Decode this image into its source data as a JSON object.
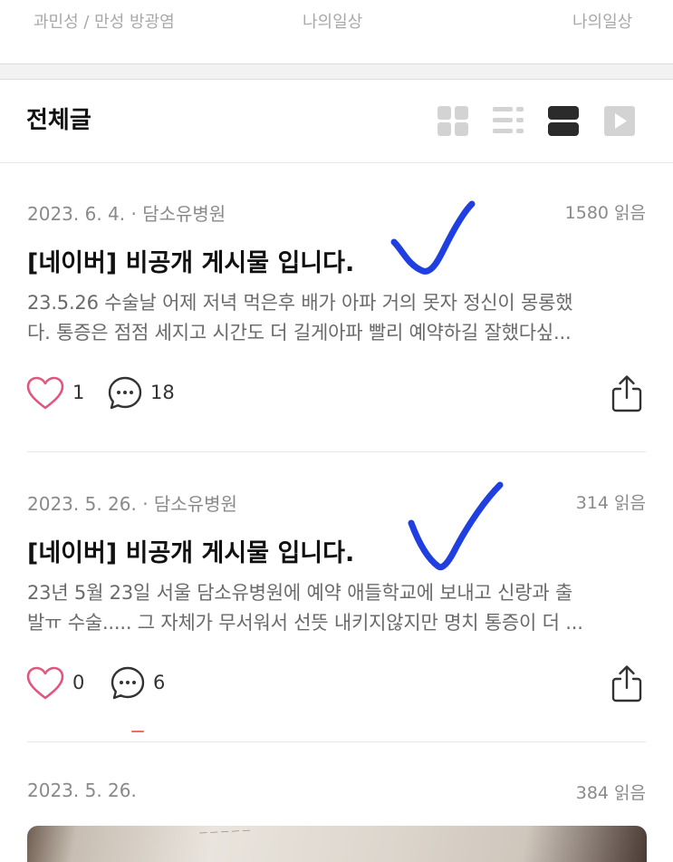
{
  "top_row": {
    "left": "과민성 / 만성 방광염",
    "center": "나의일상",
    "right": "나의일상"
  },
  "section": {
    "title": "전체글"
  },
  "view_modes": [
    "grid-view-icon",
    "list-view-icon",
    "card-view-icon",
    "video-view-icon"
  ],
  "posts": [
    {
      "meta": "2023. 6. 4. · 담소유병원",
      "reads": "1580 읽음",
      "title": "[네이버] 비공개 게시물 입니다.",
      "excerpt_line1": "23.5.26 수술날 어제 저녁 먹은후 배가 아파 거의 못자 정신이 몽롱했",
      "excerpt_line2": "다. 통증은 점점 세지고 시간도 더 길게아파 빨리 예약하길 잘했다싶...",
      "likes": "1",
      "comments": "18"
    },
    {
      "meta": "2023. 5. 26. · 담소유병원",
      "reads": "314 읽음",
      "title": "[네이버] 비공개 게시물 입니다.",
      "excerpt_line1": "23년 5월 23일 서울 담소유병원에 예약 애들학교에 보내고 신랑과 출",
      "excerpt_line2": "발ㅠ 수술..... 그 자체가 무서워서 선뜻 내키지않지만 명치 통증이 더 ...",
      "likes": "0",
      "comments": "6"
    },
    {
      "meta": "2023. 5. 26.",
      "reads": "384 읽음"
    }
  ],
  "colors": {
    "heart": "#e0567f",
    "checkmark": "#1f3fe0",
    "meta_text": "#8a8a8a",
    "icon_gray": "#d3d3d3",
    "icon_active": "#2b2b2b"
  }
}
